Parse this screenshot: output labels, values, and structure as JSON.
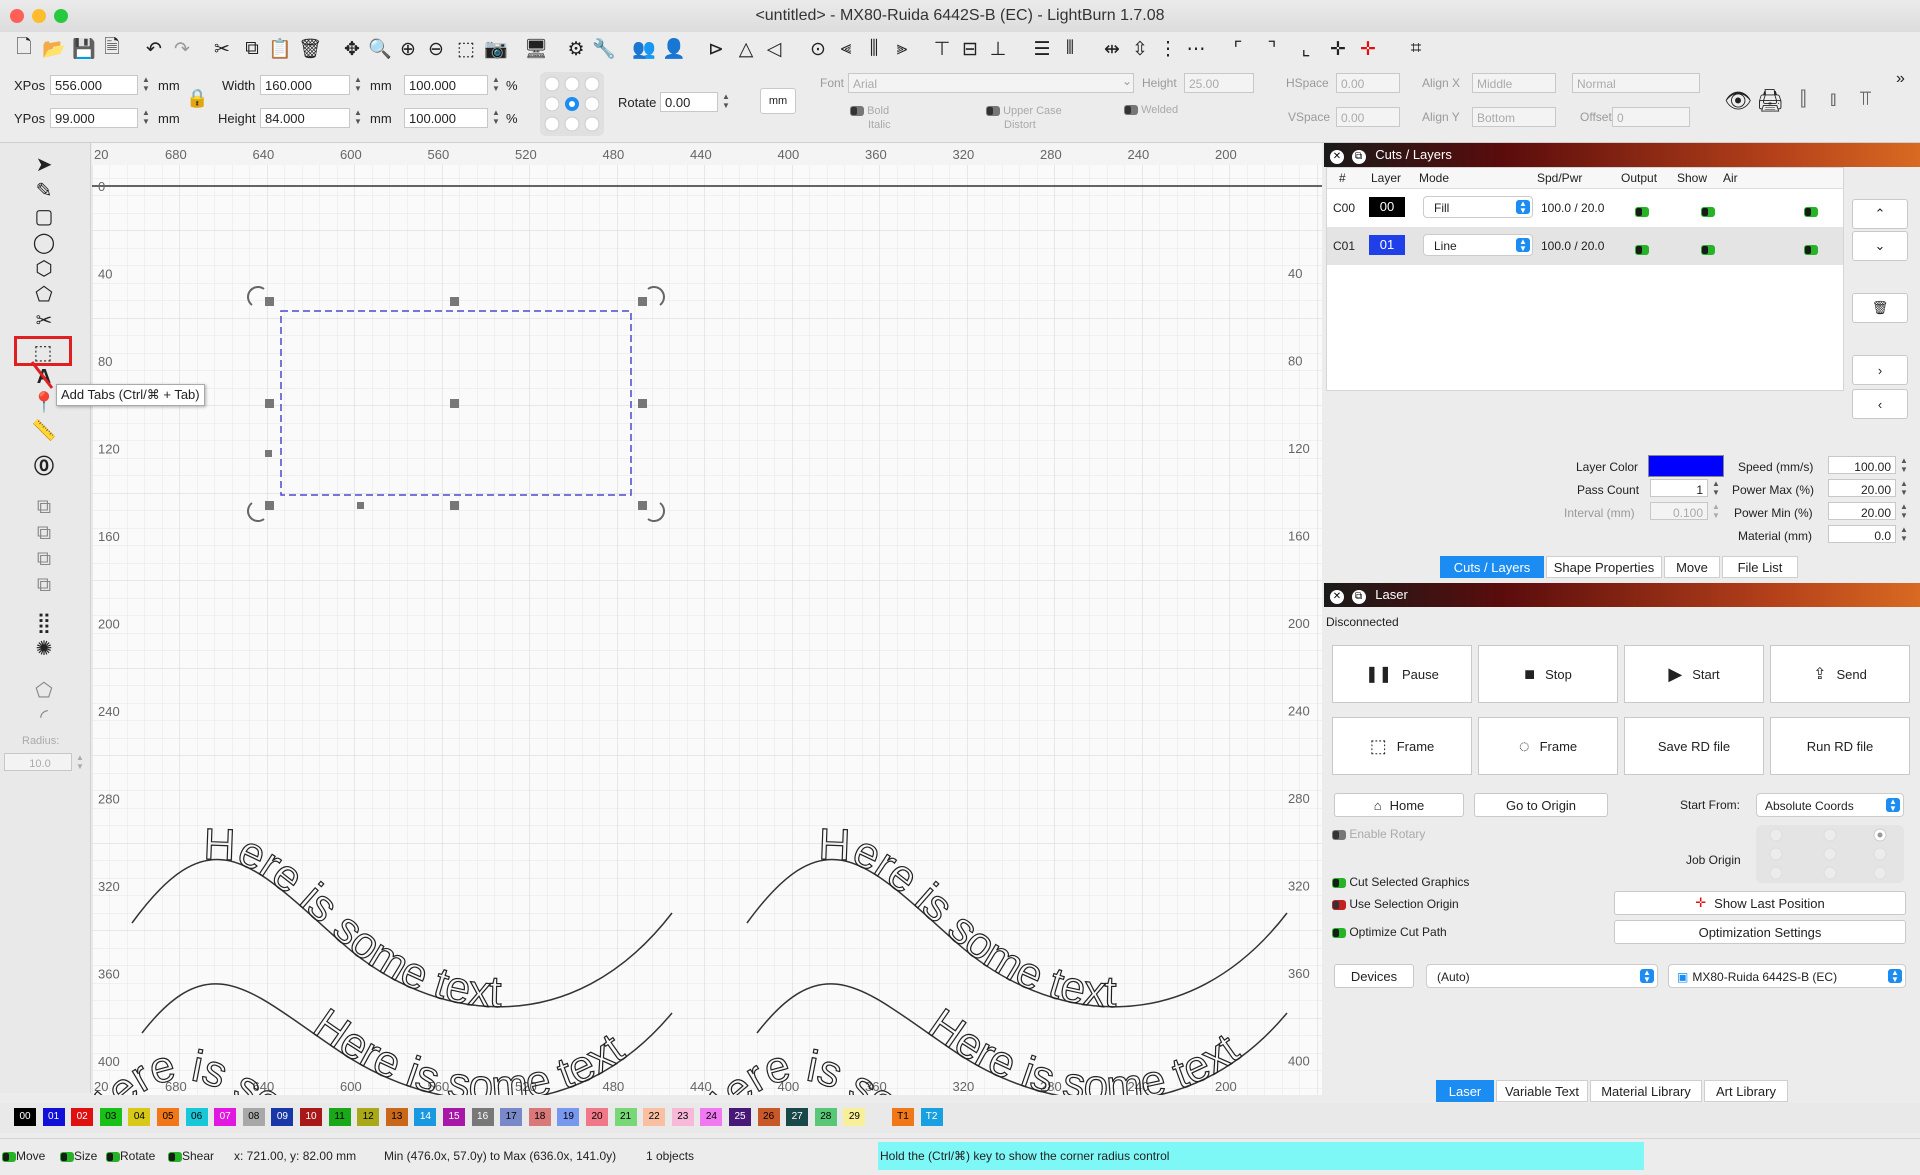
{
  "window": {
    "title": "<untitled> - MX80-Ruida 6442S-B (EC) - LightBurn 1.7.08"
  },
  "toolbar2": {
    "xpos_label": "XPos",
    "xpos_value": "556.000",
    "ypos_label": "YPos",
    "ypos_value": "99.000",
    "unit_mm": "mm",
    "width_label": "Width",
    "width_value": "160.000",
    "height_label": "Height",
    "height_value": "84.000",
    "pct_w": "100.000",
    "pct_h": "100.000",
    "pct": "%",
    "rotate_label": "Rotate",
    "rotate_value": "0.00",
    "units_button": "mm",
    "font_label": "Font",
    "font_value": "Arial",
    "font_height_label": "Height",
    "font_height_value": "25.00",
    "hspace_label": "HSpace",
    "hspace_value": "0.00",
    "vspace_label": "VSpace",
    "vspace_value": "0.00",
    "alignx_label": "Align X",
    "alignx_value": "Middle",
    "aligny_label": "Align Y",
    "aligny_value": "Bottom",
    "normal_value": "Normal",
    "offset_label": "Offset",
    "offset_value": "0",
    "bold": "Bold",
    "italic": "Italic",
    "upper_case": "Upper Case",
    "distort": "Distort",
    "welded": "Welded"
  },
  "left_toolbar": {
    "radius_label": "Radius:",
    "radius_value": "10.0"
  },
  "tooltip": {
    "text": "Add Tabs (Ctrl/⌘ + Tab)"
  },
  "canvas": {
    "top_ruler": [
      "20",
      "680",
      "640",
      "600",
      "560",
      "520",
      "480",
      "440",
      "400",
      "360",
      "320",
      "280",
      "240",
      "200"
    ],
    "bottom_ruler": [
      "20",
      "680",
      "640",
      "600",
      "560",
      "520",
      "480",
      "440",
      "400",
      "360",
      "320",
      "280",
      "240",
      "200"
    ],
    "left_ruler": [
      "0",
      "40",
      "80",
      "120",
      "160",
      "200",
      "240",
      "280",
      "320",
      "360",
      "400"
    ],
    "right_ruler": [
      "40",
      "80",
      "120",
      "160",
      "200",
      "240",
      "280",
      "320",
      "360",
      "400"
    ],
    "curved_text": "Here is some text"
  },
  "cuts_layers": {
    "title": "Cuts / Layers",
    "headers": [
      "#",
      "Layer",
      "Mode",
      "Spd/Pwr",
      "Output",
      "Show",
      "Air"
    ],
    "rows": [
      {
        "num": "C00",
        "layer": "00",
        "mode": "Fill",
        "spdpwr": "100.0 / 20.0",
        "color": "#000000"
      },
      {
        "num": "C01",
        "layer": "01",
        "mode": "Line",
        "spdpwr": "100.0 / 20.0",
        "color": "#1f3fe8"
      }
    ],
    "layer_color_label": "Layer Color",
    "layer_color": "#0000ff",
    "pass_count_label": "Pass Count",
    "pass_count_value": "1",
    "interval_label": "Interval (mm)",
    "interval_value": "0.100",
    "speed_label": "Speed (mm/s)",
    "speed_value": "100.00",
    "power_max_label": "Power Max (%)",
    "power_max_value": "20.00",
    "power_min_label": "Power Min (%)",
    "power_min_value": "20.00",
    "material_label": "Material (mm)",
    "material_value": "0.0",
    "tabs": [
      "Cuts / Layers",
      "Shape Properties",
      "Move",
      "File List"
    ]
  },
  "laser": {
    "title": "Laser",
    "status": "Disconnected",
    "pause": "Pause",
    "stop": "Stop",
    "start": "Start",
    "send": "Send",
    "frame1": "Frame",
    "frame2": "Frame",
    "save_rd": "Save RD file",
    "run_rd": "Run RD file",
    "home": "Home",
    "go_to_origin": "Go to Origin",
    "start_from_label": "Start From:",
    "start_from_value": "Absolute Coords",
    "enable_rotary": "Enable Rotary",
    "job_origin_label": "Job Origin",
    "cut_selected": "Cut Selected Graphics",
    "use_selection_origin": "Use Selection Origin",
    "optimize_cut_path": "Optimize Cut Path",
    "show_last_position": "Show Last Position",
    "optimization_settings": "Optimization Settings",
    "devices": "Devices",
    "devices_value": "(Auto)",
    "device_name": "MX80-Ruida 6442S-B (EC)",
    "tabs": [
      "Laser",
      "Variable Text",
      "Material Library",
      "Art Library"
    ]
  },
  "palette": [
    {
      "label": "00",
      "color": "#000000",
      "fg": "#ffffff"
    },
    {
      "label": "01",
      "color": "#1010d8",
      "fg": "#ffffff"
    },
    {
      "label": "02",
      "color": "#e01010",
      "fg": "#ffffff"
    },
    {
      "label": "03",
      "color": "#18c018",
      "fg": "#000000"
    },
    {
      "label": "04",
      "color": "#d8c818",
      "fg": "#000000"
    },
    {
      "label": "05",
      "color": "#f07818",
      "fg": "#000000"
    },
    {
      "label": "06",
      "color": "#18c8d8",
      "fg": "#000000"
    },
    {
      "label": "07",
      "color": "#e018e0",
      "fg": "#ffffff"
    },
    {
      "label": "08",
      "color": "#a8a8a8",
      "fg": "#000000"
    },
    {
      "label": "09",
      "color": "#1838a8",
      "fg": "#ffffff"
    },
    {
      "label": "10",
      "color": "#a81818",
      "fg": "#ffffff"
    },
    {
      "label": "11",
      "color": "#18a818",
      "fg": "#000000"
    },
    {
      "label": "12",
      "color": "#a8a818",
      "fg": "#000000"
    },
    {
      "label": "13",
      "color": "#c86818",
      "fg": "#000000"
    },
    {
      "label": "14",
      "color": "#1898e0",
      "fg": "#ffffff"
    },
    {
      "label": "15",
      "color": "#a818a8",
      "fg": "#ffffff"
    },
    {
      "label": "16",
      "color": "#787878",
      "fg": "#ffffff"
    },
    {
      "label": "17",
      "color": "#7888c8",
      "fg": "#000000"
    },
    {
      "label": "18",
      "color": "#d87878",
      "fg": "#000000"
    },
    {
      "label": "19",
      "color": "#7898f0",
      "fg": "#000000"
    },
    {
      "label": "20",
      "color": "#f07888",
      "fg": "#000000"
    },
    {
      "label": "21",
      "color": "#78d878",
      "fg": "#000000"
    },
    {
      "label": "22",
      "color": "#f8c0a0",
      "fg": "#000000"
    },
    {
      "label": "23",
      "color": "#f8b8d8",
      "fg": "#000000"
    },
    {
      "label": "24",
      "color": "#f078f0",
      "fg": "#000000"
    },
    {
      "label": "25",
      "color": "#481878",
      "fg": "#ffffff"
    },
    {
      "label": "26",
      "color": "#c85828",
      "fg": "#000000"
    },
    {
      "label": "27",
      "color": "#184848",
      "fg": "#ffffff"
    },
    {
      "label": "28",
      "color": "#58c878",
      "fg": "#000000"
    },
    {
      "label": "29",
      "color": "#f8f098",
      "fg": "#000000"
    },
    {
      "label": "T1",
      "color": "#f07818",
      "fg": "#000000"
    },
    {
      "label": "T2",
      "color": "#18a0e0",
      "fg": "#ffffff"
    }
  ],
  "status_bar": {
    "move": "Move",
    "size": "Size",
    "rotate": "Rotate",
    "shear": "Shear",
    "coords": "x: 721.00, y: 82.00 mm",
    "minmax": "Min (476.0x, 57.0y) to Max (636.0x, 141.0y)",
    "objects": "1 objects",
    "hint": "Hold the (Ctrl/⌘) key to show the corner radius control"
  }
}
